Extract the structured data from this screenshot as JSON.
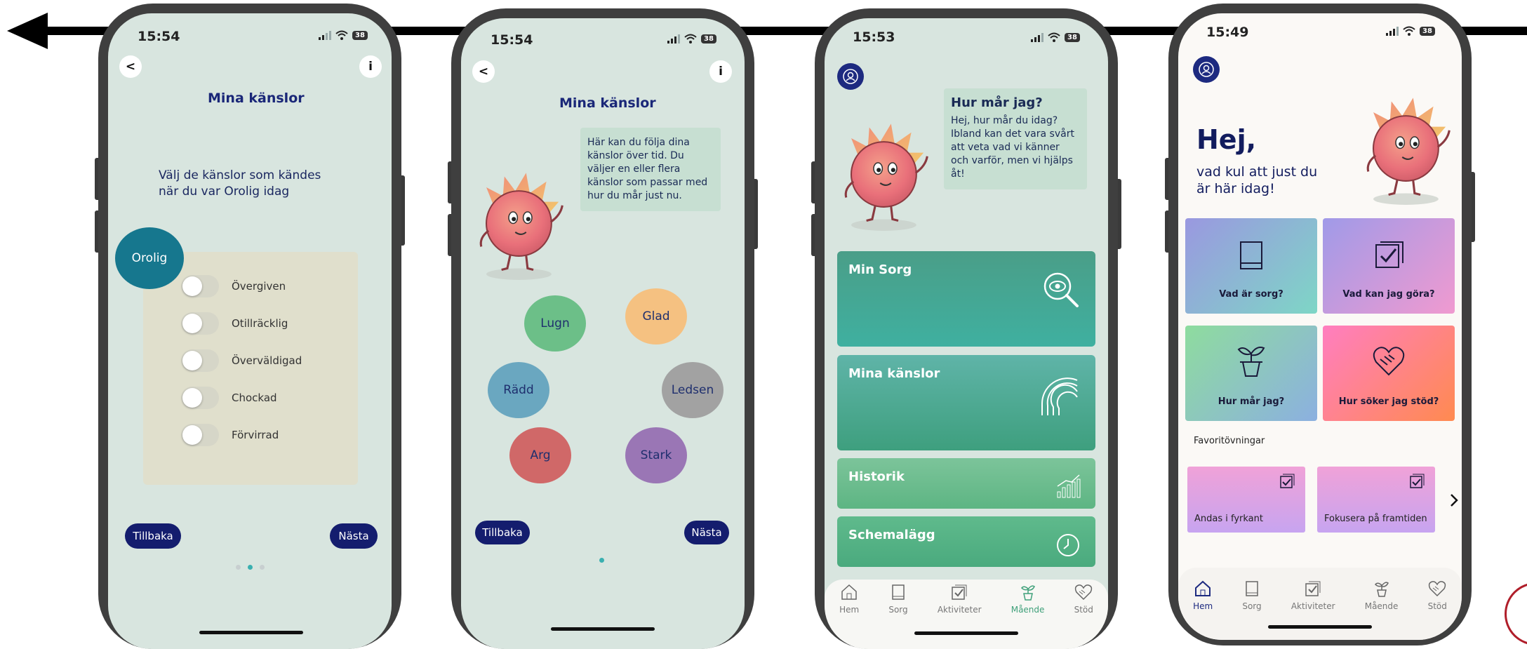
{
  "screens": [
    {
      "time": "15:54",
      "battery": "38",
      "back_label": "<",
      "info_label": "i",
      "title": "Mina känslor",
      "prompt": "Välj de känslor som kändes när du var Orolig idag",
      "selected_emotion": "Orolig",
      "options": [
        "Övergiven",
        "Otillräcklig",
        "Överväldigad",
        "Chockad",
        "Förvirrad"
      ],
      "back_button": "Tillbaka",
      "next_button": "Nästa",
      "colors": {
        "background": "#d8e5df",
        "accent": "#16778e",
        "panel": "#e0dfcc"
      }
    },
    {
      "time": "15:54",
      "battery": "38",
      "back_label": "<",
      "info_label": "i",
      "title": "Mina känslor",
      "speech": "Här kan du följa dina känslor över tid. Du väljer en eller flera känslor som passar med hur du mår just nu.",
      "emotions": [
        {
          "label": "Lugn",
          "color": "#6cbf88"
        },
        {
          "label": "Glad",
          "color": "#f5c181"
        },
        {
          "label": "Rädd",
          "color": "#6aa7c0"
        },
        {
          "label": "Ledsen",
          "color": "#a2a2a2"
        },
        {
          "label": "Arg",
          "color": "#d06868"
        },
        {
          "label": "Stark",
          "color": "#9a76b5"
        }
      ],
      "back_button": "Tillbaka",
      "next_button": "Nästa"
    },
    {
      "time": "15:53",
      "battery": "38",
      "speech_title": "Hur mår jag?",
      "speech": "Hej, hur mår du idag? Ibland kan det vara svårt att veta vad vi känner och varför, men vi hjälps åt!",
      "cards": [
        {
          "label": "Min Sorg",
          "icon": "magnifier-eye-icon",
          "color_top": "#4a9e88",
          "color_bottom": "#3fb0a0"
        },
        {
          "label": "Mina känslor",
          "icon": "rainbow-icon",
          "color_top": "#5fb4a8",
          "color_bottom": "#3e9f7e"
        },
        {
          "label": "Historik",
          "icon": "bar-chart-icon",
          "color_top": "#7cc49a",
          "color_bottom": "#5db583"
        },
        {
          "label": "Schemalägg",
          "icon": "clock-icon",
          "color_top": "#5fba8c",
          "color_bottom": "#4aaa7e"
        }
      ],
      "tabs": [
        {
          "label": "Hem",
          "icon": "home-icon"
        },
        {
          "label": "Sorg",
          "icon": "book-icon"
        },
        {
          "label": "Aktiviteter",
          "icon": "checklist-icon"
        },
        {
          "label": "Mående",
          "icon": "plant-icon"
        },
        {
          "label": "Stöd",
          "icon": "handshake-heart-icon"
        }
      ],
      "active_tab": "Mående"
    },
    {
      "time": "15:49",
      "battery": "38",
      "greeting": "Hej,",
      "subgreeting": "vad kul att just du är här idag!",
      "tiles": [
        {
          "label": "Vad är sorg?",
          "icon": "book-icon"
        },
        {
          "label": "Vad kan jag göra?",
          "icon": "checklist-icon"
        },
        {
          "label": "Hur mår jag?",
          "icon": "plant-icon"
        },
        {
          "label": "Hur söker jag stöd?",
          "icon": "handshake-heart-icon"
        }
      ],
      "favorites_heading": "Favoritövningar",
      "favorites": [
        "Andas i fyrkant",
        "Fokusera på framtiden"
      ],
      "tabs": [
        {
          "label": "Hem",
          "icon": "home-icon"
        },
        {
          "label": "Sorg",
          "icon": "book-icon"
        },
        {
          "label": "Aktiviteter",
          "icon": "checklist-icon"
        },
        {
          "label": "Mående",
          "icon": "plant-icon"
        },
        {
          "label": "Stöd",
          "icon": "handshake-heart-icon"
        }
      ],
      "active_tab": "Hem"
    }
  ]
}
